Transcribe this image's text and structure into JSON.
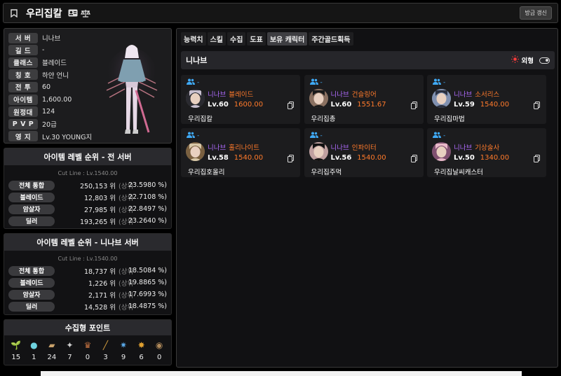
{
  "header": {
    "title": "우리집칼",
    "refresh_label": "방금 갱신"
  },
  "profile": {
    "rows": [
      {
        "label": "서  버",
        "value": "니나브"
      },
      {
        "label": "길  드",
        "value": "-"
      },
      {
        "label": "클래스",
        "value": "블레이드"
      },
      {
        "label": "칭  호",
        "value": "하얀 언니"
      },
      {
        "label": "전  투",
        "value": "60"
      },
      {
        "label": "아이템",
        "value": "1,600.00"
      },
      {
        "label": "원정대",
        "value": "124"
      },
      {
        "label": "P V P",
        "value": "20급"
      },
      {
        "label": "영  지",
        "value": "Lv.30 YOUNG지"
      }
    ]
  },
  "rank_all": {
    "title": "아이템 레벨 순위 - 전 서버",
    "cutline": "Cut Line : Lv.1540.00",
    "rows": [
      {
        "label": "전체 통합",
        "rank": "250,153 위",
        "sang": "(상위",
        "pct": "23.5980 %)"
      },
      {
        "label": "블레이드",
        "rank": "12,803 위",
        "sang": "(상위",
        "pct": "22.7108 %)"
      },
      {
        "label": "암살자",
        "rank": "27,985 위",
        "sang": "(상위",
        "pct": "22.8497 %)"
      },
      {
        "label": "딜러",
        "rank": "193,265 위",
        "sang": "(상위",
        "pct": "23.2640 %)"
      }
    ]
  },
  "rank_server": {
    "title": "아이템 레벨 순위 - 니나브 서버",
    "cutline": "Cut Line : Lv.1540.00",
    "rows": [
      {
        "label": "전체 통합",
        "rank": "18,737 위",
        "sang": "(상위",
        "pct": "18.5084 %)"
      },
      {
        "label": "블레이드",
        "rank": "1,226 위",
        "sang": "(상위",
        "pct": "19.8865 %)"
      },
      {
        "label": "암살자",
        "rank": "2,171 위",
        "sang": "(상위",
        "pct": "17.6993 %)"
      },
      {
        "label": "딜러",
        "rank": "14,528 위",
        "sang": "(상위",
        "pct": "18.4875 %)"
      }
    ]
  },
  "collect": {
    "title": "수집형 포인트",
    "items": [
      {
        "icon": "mokoko-seed-icon",
        "value": "15"
      },
      {
        "icon": "island-heart-icon",
        "value": "1"
      },
      {
        "icon": "great-art-icon",
        "value": "24"
      },
      {
        "icon": "giant-heart-icon",
        "value": "7"
      },
      {
        "icon": "ignea-token-icon",
        "value": "0"
      },
      {
        "icon": "sea-bounty-icon",
        "value": "3"
      },
      {
        "icon": "world-tree-leaf-icon",
        "value": "9"
      },
      {
        "icon": "orpheus-star-icon",
        "value": "6"
      },
      {
        "icon": "omnium-star-icon",
        "value": "0"
      }
    ]
  },
  "tabs": [
    "능력치",
    "스킬",
    "수집",
    "도표",
    "보유 캐릭터",
    "주간골드획득"
  ],
  "active_tab": 4,
  "server_section": {
    "name": "니나브",
    "appearance_label": "외형"
  },
  "characters": [
    {
      "group": "-",
      "server": "니나브",
      "class": "블레이드",
      "level": "Lv.60",
      "item_level": "1600.00",
      "name": "우리집칼"
    },
    {
      "group": "-",
      "server": "니나브",
      "class": "건슬링어",
      "level": "Lv.60",
      "item_level": "1551.67",
      "name": "우리집총"
    },
    {
      "group": "-",
      "server": "니나브",
      "class": "소서리스",
      "level": "Lv.59",
      "item_level": "1540.00",
      "name": "우리집마법"
    },
    {
      "group": "-",
      "server": "니나브",
      "class": "홀리나이트",
      "level": "Lv.58",
      "item_level": "1540.00",
      "name": "우리집호올리"
    },
    {
      "group": "-",
      "server": "니나브",
      "class": "인파이터",
      "level": "Lv.56",
      "item_level": "1540.00",
      "name": "우리집주먹"
    },
    {
      "group": "-",
      "server": "니나브",
      "class": "기상술사",
      "level": "Lv.50",
      "item_level": "1340.00",
      "name": "우리집날씨캐스터"
    }
  ],
  "colors": {
    "class_text": "#ff7a2b",
    "server_text": "#b06bff",
    "group_icon": "#3fa9f5",
    "panel_bg": "#1c1c1e"
  }
}
